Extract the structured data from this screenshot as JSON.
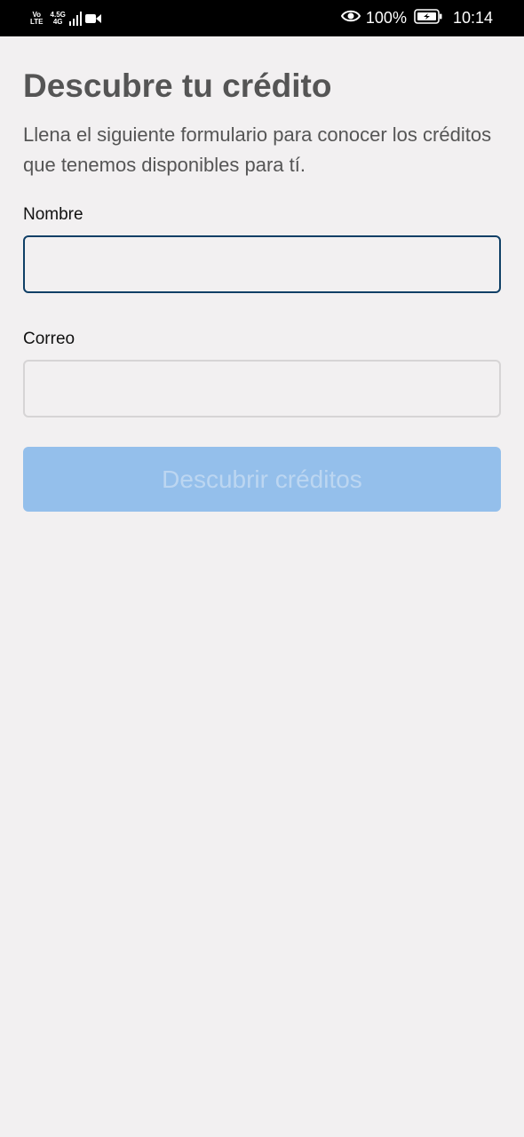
{
  "status_bar": {
    "volte_top": "Vo",
    "volte_bottom": "LTE",
    "network_type": "4.5G",
    "network_sub": "4G",
    "battery_percent": "100%",
    "time": "10:14"
  },
  "form": {
    "title": "Descubre tu crédito",
    "description": "Llena el siguiente formulario para conocer los créditos que tenemos disponibles para tí.",
    "name_label": "Nombre",
    "name_value": "",
    "email_label": "Correo",
    "email_value": "",
    "submit_label": "Descubrir créditos"
  },
  "colors": {
    "background": "#f2f0f1",
    "focused_border": "#0f3f66",
    "button_disabled": "#94bfeb",
    "text_secondary": "#555555"
  },
  "icons": [
    "signal-icon",
    "video-call-icon",
    "eye-comfort-icon",
    "battery-icon"
  ]
}
